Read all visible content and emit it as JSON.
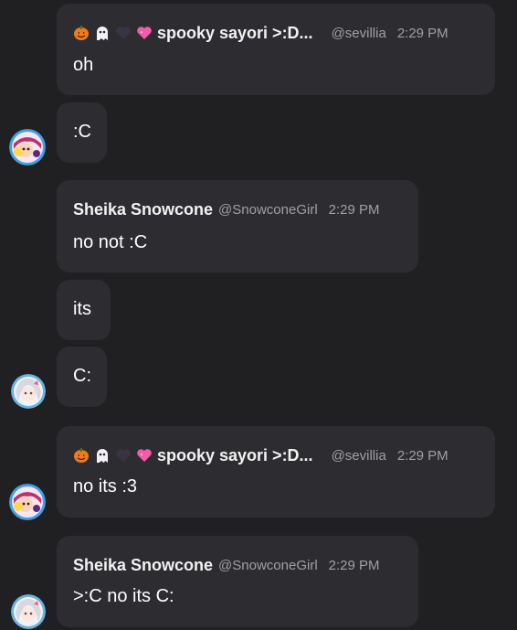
{
  "messages": [
    {
      "name": "spooky sayori >:D...",
      "handle": "@sevillia",
      "time": "2:29 PM",
      "text": "oh"
    },
    {
      "text": ":C"
    },
    {
      "name": "Sheika Snowcone",
      "handle": "@SnowconeGirl",
      "time": "2:29 PM",
      "text": "no not :C"
    },
    {
      "text": "its"
    },
    {
      "text": "C:"
    },
    {
      "name": "spooky sayori >:D...",
      "handle": "@sevillia",
      "time": "2:29 PM",
      "text": "no its :3"
    },
    {
      "name": "Sheika Snowcone",
      "handle": "@SnowconeGirl",
      "time": "2:29 PM",
      "text": ">:C no its C:"
    }
  ],
  "icons": {
    "badge1": "pumpkin-icon",
    "badge2": "ghost-icon",
    "badge3": "black-heart-icon",
    "badge4": "sparkling-heart-icon"
  },
  "colors": {
    "background": "#202022",
    "bubble": "#2d2c30",
    "muted_text": "#a0a0a4",
    "pumpkin": "#f07a1a",
    "heart_pink": "#f25ca8",
    "heart_black": "#3a3344"
  }
}
